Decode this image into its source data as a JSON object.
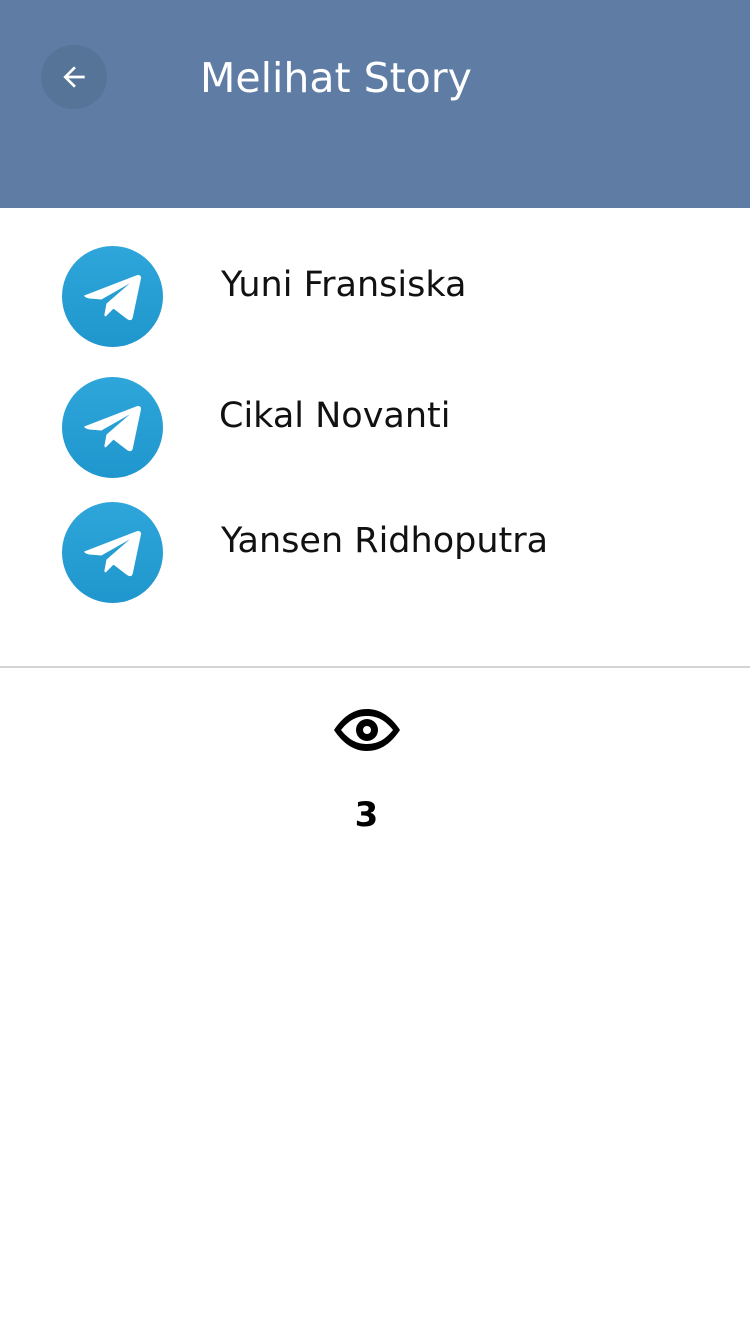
{
  "header": {
    "title": "Melihat Story",
    "back_icon": "arrow-left-icon",
    "background_color": "#5e7ca4"
  },
  "viewers": [
    {
      "name": "Yuni Fransiska",
      "avatar_icon": "telegram-icon"
    },
    {
      "name": "Cikal Novanti",
      "avatar_icon": "telegram-icon"
    },
    {
      "name": "Yansen Ridhoputra",
      "avatar_icon": "telegram-icon"
    }
  ],
  "views": {
    "icon": "eye-icon",
    "count": "3"
  },
  "colors": {
    "accent": "#2aa3d8",
    "divider": "#d4d4d4"
  }
}
